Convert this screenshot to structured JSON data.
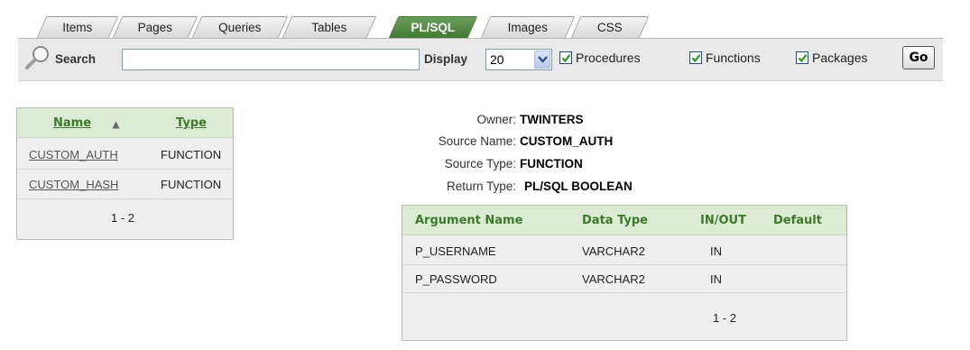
{
  "tabs": [
    {
      "label": "Items",
      "active": false
    },
    {
      "label": "Pages",
      "active": false
    },
    {
      "label": "Queries",
      "active": false
    },
    {
      "label": "Tables",
      "active": false
    },
    {
      "label": "PL/SQL",
      "active": true
    },
    {
      "label": "Images",
      "active": false
    },
    {
      "label": "CSS",
      "active": false
    }
  ],
  "search": {
    "icon": "search-icon",
    "label": "Search",
    "value": "",
    "display_label": "Display",
    "display_value": "20",
    "checkboxes": [
      {
        "label": "Procedures",
        "checked": true
      },
      {
        "label": "Functions",
        "checked": true
      },
      {
        "label": "Packages",
        "checked": true
      }
    ],
    "go_label": "Go"
  },
  "objects_report": {
    "headers": {
      "name": "Name",
      "type": "Type"
    },
    "sort_icon": "sort-ascending-icon",
    "rows": [
      {
        "name": "CUSTOM_AUTH",
        "type": "FUNCTION"
      },
      {
        "name": "CUSTOM_HASH",
        "type": "FUNCTION"
      }
    ],
    "pagination": "1 - 2"
  },
  "detail": {
    "owner_label": "Owner:",
    "owner": "TWINTERS",
    "source_name_label": "Source Name:",
    "source_name": "CUSTOM_AUTH",
    "source_type_label": "Source Type:",
    "source_type": "FUNCTION",
    "return_type_label": "Return Type:",
    "return_type": "PL/SQL BOOLEAN"
  },
  "arguments_report": {
    "headers": {
      "argument_name": "Argument Name",
      "data_type": "Data Type",
      "in_out": "IN/OUT",
      "default": "Default"
    },
    "rows": [
      {
        "argument_name": "P_USERNAME",
        "data_type": "VARCHAR2",
        "in_out": "IN",
        "default": ""
      },
      {
        "argument_name": "P_PASSWORD",
        "data_type": "VARCHAR2",
        "in_out": "IN",
        "default": ""
      }
    ],
    "pagination": "1 - 2"
  },
  "colors": {
    "accent_green": "#3f7a32",
    "header_bg": "#dcebd3",
    "header_text": "#3d7a2d"
  }
}
